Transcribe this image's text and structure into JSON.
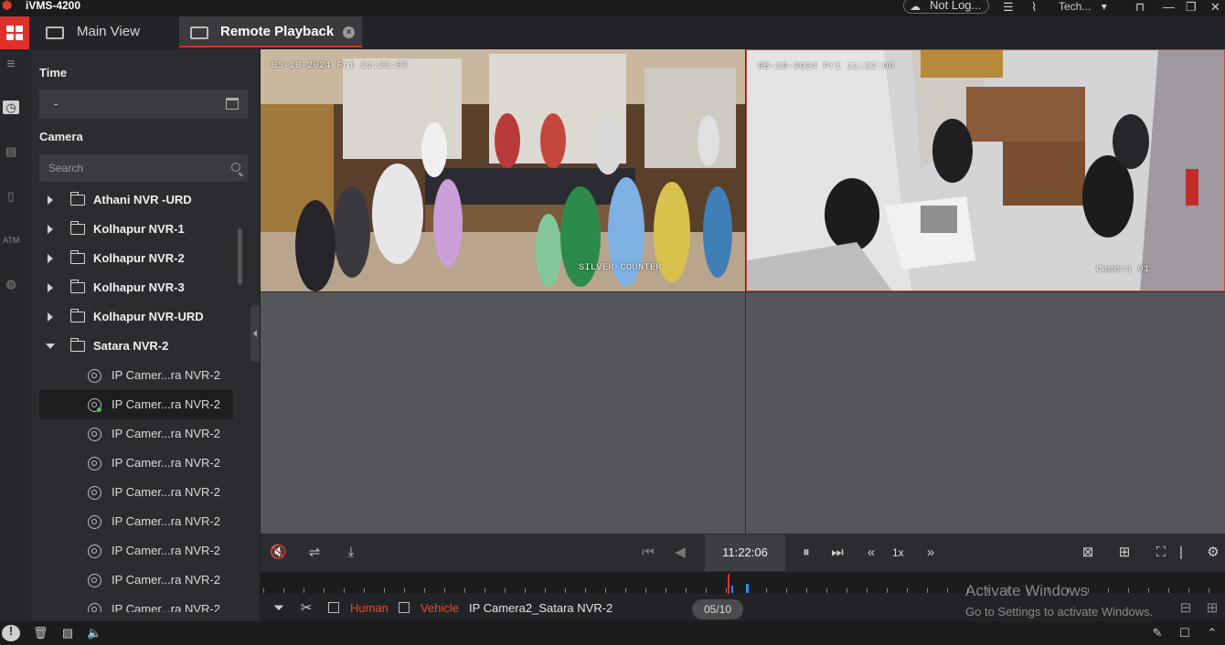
{
  "app": {
    "title": "iVMS-4200"
  },
  "titlebar": {
    "user": "Not Log...",
    "account": "Tech..."
  },
  "tabs": [
    {
      "label": "Main View"
    },
    {
      "label": "Remote Playback"
    }
  ],
  "panel": {
    "time_label": "Time",
    "time_value": "-",
    "camera_label": "Camera",
    "search_placeholder": "Search",
    "groups": [
      {
        "label": "Athani NVR -URD"
      },
      {
        "label": "Kolhapur NVR-1"
      },
      {
        "label": "Kolhapur NVR-2"
      },
      {
        "label": "Kolhapur NVR-3"
      },
      {
        "label": "Kolhapur NVR-URD"
      },
      {
        "label": "Satara NVR-2"
      }
    ],
    "cameras": [
      {
        "label": "IP Camer...ra NVR-2"
      },
      {
        "label": "IP Camer...ra NVR-2"
      },
      {
        "label": "IP Camer...ra NVR-2"
      },
      {
        "label": "IP Camer...ra NVR-2"
      },
      {
        "label": "IP Camer...ra NVR-2"
      },
      {
        "label": "IP Camer...ra NVR-2"
      },
      {
        "label": "IP Camer...ra NVR-2"
      },
      {
        "label": "IP Camer...ra NVR-2"
      },
      {
        "label": "IP Camer...ra NVR-2"
      }
    ]
  },
  "video": {
    "tile1": {
      "timestamp": "05-10-2024 Fri 11:22:07",
      "name": "SILVER COUNTER"
    },
    "tile2": {
      "timestamp": "05-10-2024 Fri 11:22:06",
      "name": "Camera 01"
    }
  },
  "controls": {
    "time": "11:22:06",
    "speed": "1x"
  },
  "filter": {
    "human": "Human",
    "vehicle": "Vehicle",
    "camera": "IP Camera2_Satara NVR-2",
    "date": "05/10"
  },
  "watermark": {
    "line1": "Activate Windows",
    "line2": "Go to Settings to activate Windows."
  },
  "colors": {
    "accent": "#e0302c",
    "human": "#e0502a",
    "vehicle": "#e0502a"
  }
}
